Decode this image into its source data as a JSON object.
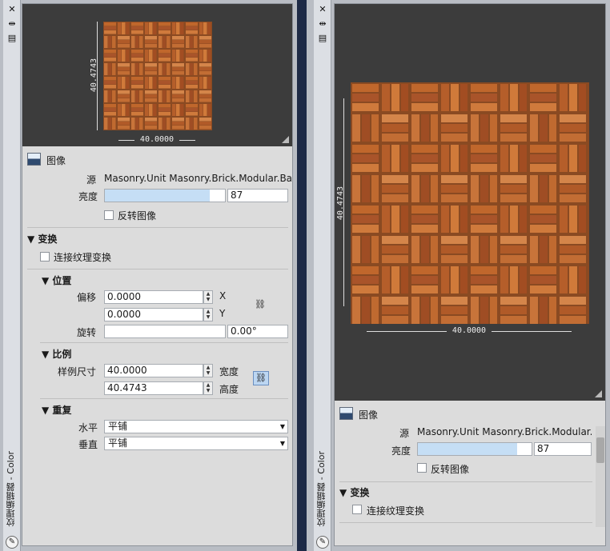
{
  "palette_title": "纹理编辑器 - Color",
  "left": {
    "preview": {
      "height_label": "40.4743",
      "width_label": "40.0000"
    },
    "image_section": {
      "title": "图像",
      "source_label": "源",
      "source_value": "Masonry.Unit Masonry.Brick.Modular.Ba",
      "brightness_label": "亮度",
      "brightness_value": "87",
      "brightness_fraction": 0.87,
      "invert_label": "反转图像"
    },
    "transforms": {
      "title": "变换",
      "link_label": "连接纹理变换",
      "position": {
        "title": "位置",
        "offset_label": "偏移",
        "offset_x": "0.0000",
        "offset_y": "0.0000",
        "x_label": "X",
        "y_label": "Y",
        "rotation_label": "旋转",
        "rotation_value": "",
        "rotation_deg": "0.00°"
      },
      "scale": {
        "title": "比例",
        "size_label": "样例尺寸",
        "width_value": "40.0000",
        "height_value": "40.4743",
        "width_label": "宽度",
        "height_label": "高度"
      },
      "repeat": {
        "title": "重复",
        "horizontal_label": "水平",
        "horizontal_value": "平铺",
        "vertical_label": "垂直",
        "vertical_value": "平铺"
      }
    }
  },
  "right": {
    "preview": {
      "height_label": "40.4743",
      "width_label": "40.0000"
    },
    "image_section": {
      "title": "图像",
      "source_label": "源",
      "source_value": "Masonry.Unit Masonry.Brick.Modular.",
      "brightness_label": "亮度",
      "brightness_value": "87",
      "brightness_fraction": 0.87,
      "invert_label": "反转图像"
    },
    "transforms": {
      "title": "变换",
      "link_label": "连接纹理变换"
    }
  },
  "colors": {
    "preview_bg": "#3c3c3c",
    "panel_bg": "#dcdcdc",
    "slider_fill": "#c5def5",
    "brick": "#b45a24"
  },
  "icons": [
    "close-icon",
    "pin-icon",
    "properties-icon",
    "image-icon",
    "chain-link-icon",
    "pen-icon"
  ]
}
